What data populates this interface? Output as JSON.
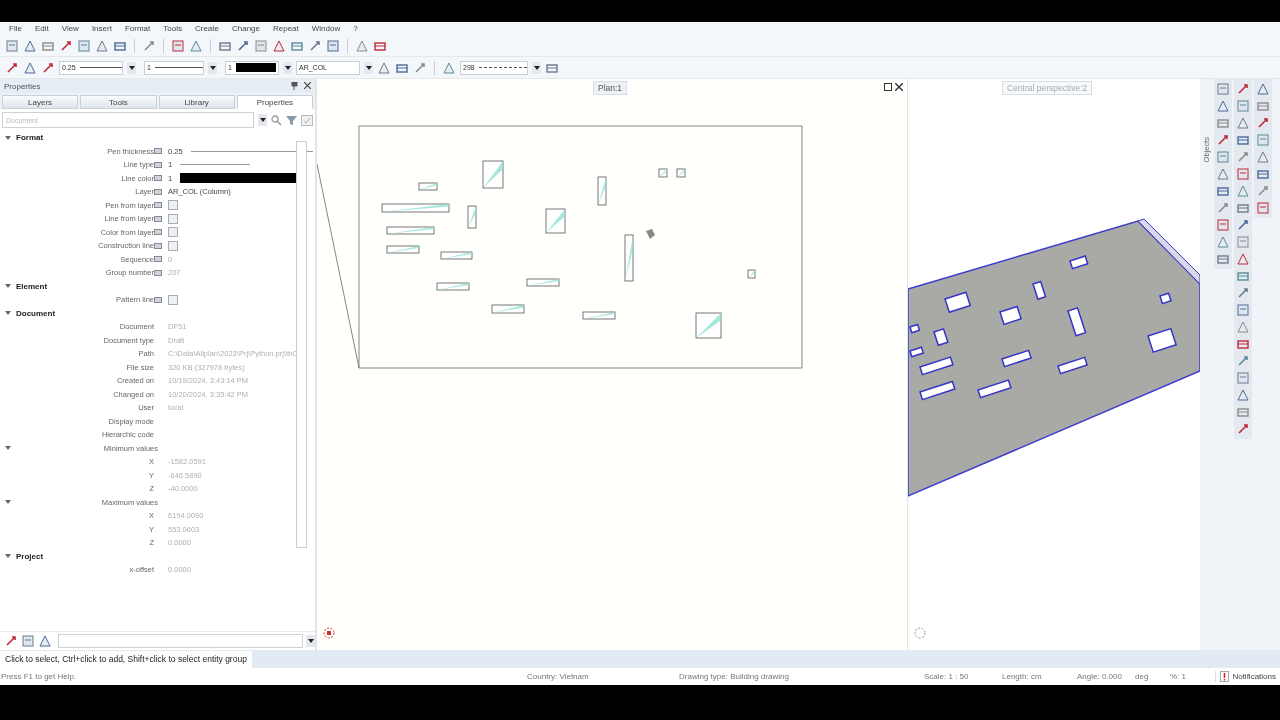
{
  "menu": [
    "File",
    "Edit",
    "View",
    "Insert",
    "Format",
    "Tools",
    "Create",
    "Change",
    "Repeat",
    "Window",
    "?"
  ],
  "format_bar": {
    "pen": "0.25",
    "line": "1",
    "color_number": "1",
    "layer": "AR_COL",
    "pattern": "298"
  },
  "panel": {
    "title": "Properties",
    "tabs": [
      {
        "label": "Layers",
        "selected": false
      },
      {
        "label": "Tools",
        "selected": false
      },
      {
        "label": "Library",
        "selected": false
      },
      {
        "label": "Properties",
        "selected": true
      }
    ],
    "filter": {
      "placeholder": "Document"
    },
    "sections": [
      {
        "title": "Format",
        "expanded": true,
        "rows": [
          {
            "label": "Pen thickness",
            "kind": "line",
            "value": "0.25",
            "disabled": false
          },
          {
            "label": "Line type",
            "kind": "line",
            "value": "1",
            "disabled": false
          },
          {
            "label": "Line color",
            "kind": "color",
            "value": "1",
            "disabled": false
          },
          {
            "label": "Layer",
            "kind": "layer",
            "value": "AR_COL (Column)",
            "disabled": false
          },
          {
            "label": "Pen from layer",
            "kind": "checkbox",
            "checked": false
          },
          {
            "label": "Line from layer",
            "kind": "checkbox",
            "checked": false
          },
          {
            "label": "Color from layer",
            "kind": "checkbox",
            "checked": false
          },
          {
            "label": "Construction line",
            "kind": "checkbox",
            "checked": false
          },
          {
            "label": "Sequence",
            "kind": "number",
            "value": "0",
            "disabled": true
          },
          {
            "label": "Group number",
            "kind": "number",
            "value": "207",
            "disabled": true
          }
        ]
      },
      {
        "title": "Element",
        "expanded": true,
        "rows": [
          {
            "label": "Pattern line",
            "kind": "checkbox",
            "checked": false
          }
        ]
      },
      {
        "title": "Document",
        "expanded": true,
        "rows": [
          {
            "label": "Document",
            "kind": "text",
            "value": "DF51",
            "disabled": true
          },
          {
            "label": "Document type",
            "kind": "text",
            "value": "Draft",
            "disabled": true
          },
          {
            "label": "Path",
            "kind": "text",
            "value": "C:\\Data\\Allplan\\2023\\Prj\\Python.prj\\tbC",
            "disabled": true
          },
          {
            "label": "File size",
            "kind": "text",
            "value": "320 KB (327978 bytes)",
            "disabled": true
          },
          {
            "label": "Created on",
            "kind": "text",
            "value": "10/19/2024, 3:43:14 PM",
            "disabled": true
          },
          {
            "label": "Changed on",
            "kind": "text",
            "value": "10/20/2024, 3:35:42 PM",
            "disabled": true
          },
          {
            "label": "User",
            "kind": "text",
            "value": "local",
            "disabled": true
          },
          {
            "label": "Display mode",
            "kind": "text"
          },
          {
            "label": "Hierarchic code",
            "kind": "text"
          },
          {
            "label": "Minimum values",
            "kind": "group",
            "expanded": true,
            "children": [
              {
                "label": "X",
                "kind": "text",
                "value": "-1582.0591",
                "disabled": true
              },
              {
                "label": "Y",
                "kind": "text",
                "value": "-646.5890",
                "disabled": true
              },
              {
                "label": "Z",
                "kind": "text",
                "value": "-40.0000",
                "disabled": true
              }
            ]
          },
          {
            "label": "Maximum values",
            "kind": "group",
            "expanded": true,
            "children": [
              {
                "label": "X",
                "kind": "text",
                "value": "6194.0090",
                "disabled": true
              },
              {
                "label": "Y",
                "kind": "text",
                "value": "553.0603",
                "disabled": true
              },
              {
                "label": "Z",
                "kind": "text",
                "value": "0.0000",
                "disabled": true
              }
            ]
          }
        ]
      },
      {
        "title": "Project",
        "expanded": true,
        "rows": [
          {
            "label": "x-offset",
            "kind": "text",
            "value": "0.0000",
            "disabled": true
          }
        ]
      }
    ]
  },
  "plan_view": {
    "title": "Plan:1"
  },
  "perspective_view": {
    "title": "Central perspective:2"
  },
  "side_tab": "Objects",
  "hint": "Click to select, Ctrl+click to add, Shift+click to select entity group",
  "status_bar": {
    "help": "Press F1 to get Help.",
    "items": [
      "Country: Vietnam",
      "Drawing type: Building drawing",
      "Scale: 1 : 50",
      "Length: cm",
      "Angle: 0.000",
      "deg",
      "%: 1"
    ],
    "notifications": "Notifications"
  }
}
